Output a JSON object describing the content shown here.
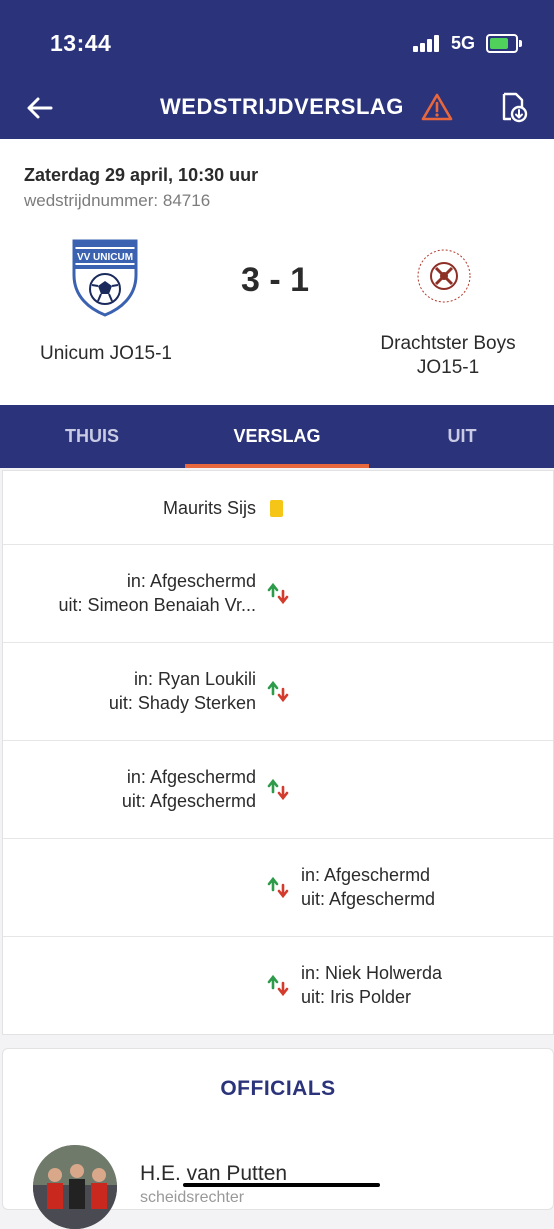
{
  "status_bar": {
    "time": "13:44",
    "network": "5G"
  },
  "header": {
    "title": "WEDSTRIJDVERSLAG"
  },
  "match": {
    "date": "Zaterdag 29 april, 10:30 uur",
    "number": "wedstrijdnummer: 84716",
    "home_team": "Unicum JO15-1",
    "away_team_line1": "Drachtster Boys",
    "away_team_line2": "JO15-1",
    "score": "3 - 1",
    "home_logo_text": "VV UNICUM"
  },
  "tabs": [
    {
      "label": "THUIS"
    },
    {
      "label": "VERSLAG",
      "active": true
    },
    {
      "label": "UIT"
    }
  ],
  "events": [
    {
      "type": "yellow-card",
      "side": "home",
      "player": "Maurits Sijs"
    },
    {
      "type": "substitution",
      "side": "home",
      "in": "in: Afgeschermd",
      "out": "uit: Simeon Benaiah Vr..."
    },
    {
      "type": "substitution",
      "side": "home",
      "in": "in: Ryan Loukili",
      "out": "uit: Shady Sterken"
    },
    {
      "type": "substitution",
      "side": "home",
      "in": "in: Afgeschermd",
      "out": "uit: Afgeschermd"
    },
    {
      "type": "substitution",
      "side": "away",
      "in": "in: Afgeschermd",
      "out": "uit: Afgeschermd"
    },
    {
      "type": "substitution",
      "side": "away",
      "in": "in: Niek Holwerda",
      "out": "uit: Iris Polder"
    }
  ],
  "officials": {
    "title": "OFFICIALS",
    "name": "H.E. van Putten",
    "role": "scheidsrechter"
  },
  "colors": {
    "primary": "#2b337b",
    "accent": "#e8673c",
    "yellow_card": "#f5c518",
    "sub_in": "#2e9b4a",
    "sub_out": "#d33b2c"
  }
}
